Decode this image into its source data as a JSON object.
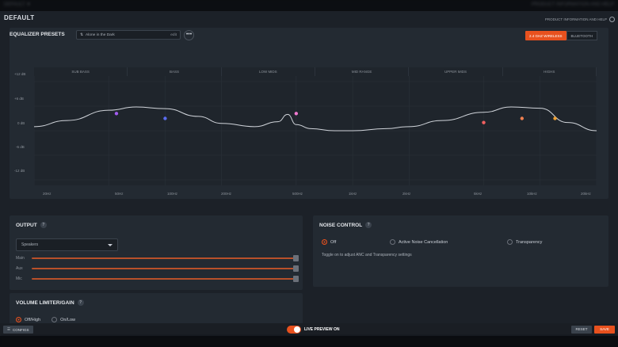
{
  "window": {
    "blur_left": "DEFAULT ▼",
    "blur_right": "PRODUCT INFORMATION AND HELP"
  },
  "header": {
    "title": "DEFAULT",
    "help_link": "PRODUCT INFORMATION AND HELP"
  },
  "equalizer": {
    "heading": "EQUALIZER PRESETS",
    "preset_value": "Alone in the Dark",
    "preset_edit": "edit",
    "more": "•••",
    "connections": [
      "2.4 GHZ WIRELESS",
      "BLUETOOTH"
    ],
    "bands": [
      "SUB BASS",
      "BASS",
      "LOW MIDS",
      "MID RANGE",
      "UPPER MIDS",
      "HIGHS"
    ],
    "y_ticks": [
      "+12 dB",
      "+6 dB",
      "0 dB",
      "-6 dB",
      "-12 dB"
    ],
    "x_ticks": [
      "20Hz",
      "50Hz",
      "100Hz",
      "200Hz",
      "500Hz",
      "1kHz",
      "2kHz",
      "5kHz",
      "10kHz",
      "20kHz"
    ]
  },
  "chart_data": {
    "type": "line",
    "x_scale": "log",
    "x_range_hz": [
      20,
      20000
    ],
    "y_range_db": [
      -12,
      12
    ],
    "curve": {
      "x": [
        20,
        30,
        50,
        70,
        100,
        150,
        200,
        300,
        400,
        450,
        500,
        600,
        800,
        1000,
        1500,
        2000,
        3000,
        5000,
        7000,
        10000,
        14000,
        20000
      ],
      "y": [
        1,
        2.5,
        5,
        5.8,
        5.4,
        3.5,
        1.8,
        1,
        2.2,
        4,
        1.5,
        0.5,
        0,
        0,
        0.5,
        1,
        2.5,
        4.5,
        5.8,
        5.5,
        2,
        0
      ]
    },
    "bands": [
      {
        "freq": "55Hz",
        "gain": 4.2,
        "color": "#a25cf0"
      },
      {
        "freq": "100Hz",
        "gain": 3,
        "color": "#5a6cf0"
      },
      {
        "freq": "500Hz",
        "gain": 4.2,
        "color": "#f07ad0"
      },
      {
        "freq": "5kHz",
        "gain": 2,
        "color": "#f06060"
      },
      {
        "freq": "8kHz",
        "gain": 3,
        "color": "#f08050"
      },
      {
        "freq": "12kHz",
        "gain": 3,
        "color": "#f0a030"
      }
    ]
  },
  "output": {
    "heading": "OUTPUT",
    "device": "Speakers",
    "sliders": [
      {
        "label": "Main",
        "level": 1
      },
      {
        "label": "Aux",
        "level": 1
      },
      {
        "label": "Mic",
        "level": 1
      }
    ]
  },
  "volume": {
    "heading": "VOLUME LIMITER/GAIN",
    "options": [
      "Off/High",
      "On/Low"
    ],
    "selected": 0
  },
  "noise": {
    "heading": "NOISE CONTROL",
    "options": [
      "Off",
      "Active Noise Cancellation",
      "Transparency"
    ],
    "selected": 0,
    "info": "Toggle on to adjust ANC and Transparency settings"
  },
  "footer": {
    "configs": "CONFIGS",
    "live_preview": "LIVE PREVIEW ON",
    "reset": "RESET",
    "save": "SAVE"
  },
  "colors": {
    "accent": "#e8511e",
    "panel": "#232a32",
    "bg": "#1c2128"
  }
}
